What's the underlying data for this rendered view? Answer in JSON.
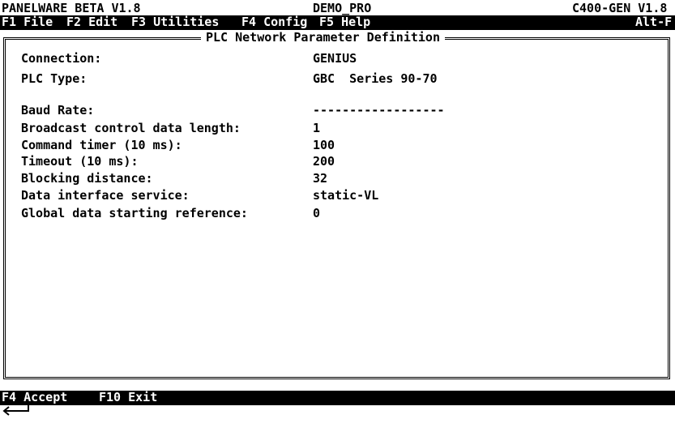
{
  "status": {
    "left": "PANELWARE BETA V1.8",
    "center": "DEMO_PRO",
    "right": "C400-GEN V1.8"
  },
  "menu": {
    "items": [
      "F1 File",
      "F2 Edit",
      "F3 Utilities",
      "F4 Config",
      "F5 Help"
    ],
    "alt": "Alt-F"
  },
  "panel": {
    "title": "PLC Network Parameter Definition",
    "fields": [
      {
        "label": "Connection:",
        "value": "GENIUS"
      },
      {
        "label": "PLC Type:",
        "value": "GBC  Series 90-70"
      },
      {
        "label": "Baud Rate:",
        "value": "------------------"
      },
      {
        "label": "Broadcast control data length:",
        "value": "1"
      },
      {
        "label": "Command timer (10 ms):",
        "value": "100"
      },
      {
        "label": "Timeout (10 ms):",
        "value": "200"
      },
      {
        "label": "Blocking distance:",
        "value": "32"
      },
      {
        "label": "Data interface service:",
        "value": "static-VL"
      },
      {
        "label": "Global data starting reference:",
        "value": "0"
      }
    ]
  },
  "footer": {
    "accept": "F4 Accept",
    "exit": "F10 Exit"
  },
  "icons": {
    "enter": "enter-arrow-icon"
  },
  "colors": {
    "background": "#ffffff",
    "foreground": "#000000",
    "bar": "#000000"
  }
}
